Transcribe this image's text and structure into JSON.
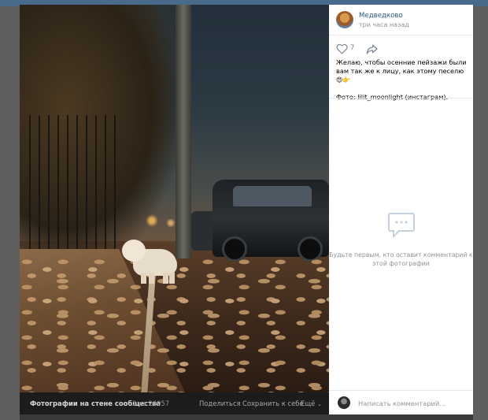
{
  "post": {
    "author": "Медведково",
    "time": "три часа назад",
    "likes": "7",
    "description_line1": "Желаю, чтобы осенние пейзажи были вам так же к лицу, как этому песелю",
    "description_line2": "Фото: lilit_moonlight (инстаграм)."
  },
  "comments": {
    "empty_text": "Будьте первым, кто оставит комментарий к этой фотографии",
    "input_placeholder": "Написать комментарий..."
  },
  "photo_bar": {
    "album": "Фотографии на стене сообщества",
    "counter": "2 из 20957",
    "share": "Поделиться",
    "save": "Сохранить к себе",
    "more": "Ещё"
  },
  "icons": {
    "like": "heart-icon",
    "repost": "share-arrow-icon",
    "comments_empty": "comments-icon",
    "emoji": [
      "heart-eyes-emoji",
      "hand-emoji"
    ]
  },
  "colors": {
    "link": "#2a5885",
    "muted": "#939393",
    "panel": "#ffffff",
    "photo_bar": "#1c1c1c"
  }
}
